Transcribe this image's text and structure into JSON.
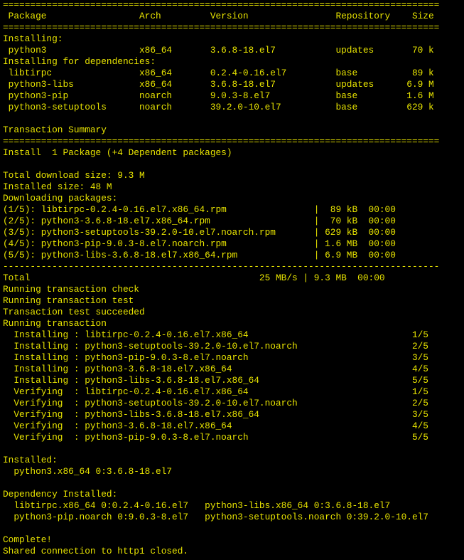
{
  "colors": {
    "background": "#000000",
    "foreground": "#e8e400"
  },
  "terminal": {
    "lines": [
      "================================================================================",
      " Package                 Arch         Version                Repository    Size",
      "================================================================================",
      "Installing:",
      " python3                 x86_64       3.6.8-18.el7           updates       70 k",
      "Installing for dependencies:",
      " libtirpc                x86_64       0.2.4-0.16.el7         base          89 k",
      " python3-libs            x86_64       3.6.8-18.el7           updates      6.9 M",
      " python3-pip             noarch       9.0.3-8.el7            base         1.6 M",
      " python3-setuptools      noarch       39.2.0-10.el7          base         629 k",
      "",
      "Transaction Summary",
      "================================================================================",
      "Install  1 Package (+4 Dependent packages)",
      "",
      "Total download size: 9.3 M",
      "Installed size: 48 M",
      "Downloading packages:",
      "(1/5): libtirpc-0.2.4-0.16.el7.x86_64.rpm                |  89 kB  00:00",
      "(2/5): python3-3.6.8-18.el7.x86_64.rpm                   |  70 kB  00:00",
      "(3/5): python3-setuptools-39.2.0-10.el7.noarch.rpm       | 629 kB  00:00",
      "(4/5): python3-pip-9.0.3-8.el7.noarch.rpm                | 1.6 MB  00:00",
      "(5/5): python3-libs-3.6.8-18.el7.x86_64.rpm              | 6.9 MB  00:00",
      "--------------------------------------------------------------------------------",
      "Total                                          25 MB/s | 9.3 MB  00:00",
      "Running transaction check",
      "Running transaction test",
      "Transaction test succeeded",
      "Running transaction",
      "  Installing : libtirpc-0.2.4-0.16.el7.x86_64                              1/5",
      "  Installing : python3-setuptools-39.2.0-10.el7.noarch                     2/5",
      "  Installing : python3-pip-9.0.3-8.el7.noarch                              3/5",
      "  Installing : python3-3.6.8-18.el7.x86_64                                 4/5",
      "  Installing : python3-libs-3.6.8-18.el7.x86_64                            5/5",
      "  Verifying  : libtirpc-0.2.4-0.16.el7.x86_64                              1/5",
      "  Verifying  : python3-setuptools-39.2.0-10.el7.noarch                     2/5",
      "  Verifying  : python3-libs-3.6.8-18.el7.x86_64                            3/5",
      "  Verifying  : python3-3.6.8-18.el7.x86_64                                 4/5",
      "  Verifying  : python3-pip-9.0.3-8.el7.noarch                              5/5",
      "",
      "Installed:",
      "  python3.x86_64 0:3.6.8-18.el7",
      "",
      "Dependency Installed:",
      "  libtirpc.x86_64 0:0.2.4-0.16.el7   python3-libs.x86_64 0:3.6.8-18.el7",
      "  python3-pip.noarch 0:9.0.3-8.el7   python3-setuptools.noarch 0:39.2.0-10.el7",
      "",
      "Complete!",
      "Shared connection to http1 closed."
    ]
  }
}
